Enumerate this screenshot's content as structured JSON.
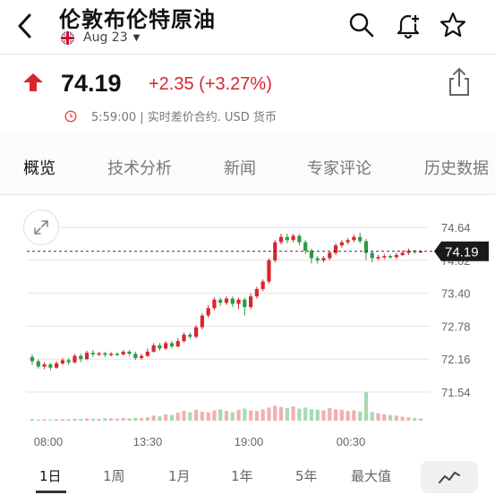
{
  "header": {
    "title": "伦敦布伦特原油",
    "contract": "Aug 23"
  },
  "quote": {
    "price": "74.19",
    "change": "+2.35 (+3.27%)",
    "time_info": "5:59:00 | 实时差价合约. USD 货币"
  },
  "tabs": [
    {
      "label": "概览",
      "active": true
    },
    {
      "label": "技术分析",
      "active": false
    },
    {
      "label": "新闻",
      "active": false
    },
    {
      "label": "专家评论",
      "active": false
    },
    {
      "label": "历史数据",
      "active": false
    }
  ],
  "ranges": [
    {
      "label": "1日",
      "active": true
    },
    {
      "label": "1周",
      "active": false
    },
    {
      "label": "1月",
      "active": false
    },
    {
      "label": "1年",
      "active": false
    },
    {
      "label": "5年",
      "active": false
    },
    {
      "label": "最大值",
      "active": false
    }
  ],
  "colors": {
    "up": "#d9262e",
    "down": "#2e9a46",
    "accent": "#d9262e"
  },
  "chart_data": {
    "type": "candlestick",
    "y_ticks": [
      "74.64",
      "74.02",
      "73.40",
      "72.78",
      "72.16",
      "71.54"
    ],
    "x_ticks": [
      "08:00",
      "13:30",
      "19:00",
      "00:30"
    ],
    "last_price_label": "74.19",
    "ylim": [
      71.54,
      74.64
    ],
    "grid": true,
    "candles": [
      [
        72.2,
        72.12,
        72.25,
        72.05
      ],
      [
        72.12,
        72.02,
        72.15,
        71.98
      ],
      [
        72.02,
        72.06,
        72.1,
        71.97
      ],
      [
        72.06,
        72.0,
        72.09,
        71.95
      ],
      [
        72.0,
        72.08,
        72.12,
        71.98
      ],
      [
        72.08,
        72.14,
        72.18,
        72.05
      ],
      [
        72.14,
        72.1,
        72.18,
        72.05
      ],
      [
        72.1,
        72.22,
        72.26,
        72.08
      ],
      [
        72.22,
        72.16,
        72.26,
        72.1
      ],
      [
        72.16,
        72.28,
        72.32,
        72.14
      ],
      [
        72.28,
        72.25,
        72.33,
        72.2
      ],
      [
        72.25,
        72.27,
        72.3,
        72.22
      ],
      [
        72.27,
        72.24,
        72.3,
        72.2
      ],
      [
        72.24,
        72.26,
        72.29,
        72.21
      ],
      [
        72.26,
        72.25,
        72.29,
        72.22
      ],
      [
        72.25,
        72.3,
        72.33,
        72.23
      ],
      [
        72.3,
        72.26,
        72.33,
        72.22
      ],
      [
        72.26,
        72.18,
        72.3,
        72.14
      ],
      [
        72.18,
        72.22,
        72.26,
        72.15
      ],
      [
        72.22,
        72.3,
        72.36,
        72.2
      ],
      [
        72.3,
        72.42,
        72.46,
        72.28
      ],
      [
        72.42,
        72.36,
        72.46,
        72.32
      ],
      [
        72.36,
        72.46,
        72.5,
        72.33
      ],
      [
        72.46,
        72.4,
        72.5,
        72.36
      ],
      [
        72.4,
        72.5,
        72.55,
        72.38
      ],
      [
        72.5,
        72.62,
        72.66,
        72.47
      ],
      [
        72.62,
        72.58,
        72.66,
        72.54
      ],
      [
        72.58,
        72.76,
        72.8,
        72.55
      ],
      [
        72.76,
        72.98,
        73.02,
        72.72
      ],
      [
        72.98,
        73.12,
        73.18,
        72.94
      ],
      [
        73.12,
        73.28,
        73.32,
        73.08
      ],
      [
        73.28,
        73.22,
        73.32,
        73.16
      ],
      [
        73.22,
        73.3,
        73.34,
        73.18
      ],
      [
        73.3,
        73.2,
        73.34,
        73.14
      ],
      [
        73.2,
        73.28,
        73.32,
        73.1
      ],
      [
        73.28,
        73.14,
        73.32,
        72.98
      ],
      [
        73.14,
        73.34,
        73.4,
        73.1
      ],
      [
        73.34,
        73.48,
        73.52,
        73.3
      ],
      [
        73.48,
        73.62,
        73.66,
        73.44
      ],
      [
        73.62,
        74.02,
        74.06,
        73.58
      ],
      [
        74.02,
        74.36,
        74.4,
        73.98
      ],
      [
        74.36,
        74.46,
        74.52,
        74.32
      ],
      [
        74.46,
        74.4,
        74.52,
        74.34
      ],
      [
        74.4,
        74.48,
        74.52,
        74.36
      ],
      [
        74.48,
        74.36,
        74.52,
        74.3
      ],
      [
        74.36,
        74.2,
        74.4,
        74.14
      ],
      [
        74.2,
        74.06,
        74.24,
        73.96
      ],
      [
        74.06,
        74.02,
        74.1,
        73.96
      ],
      [
        74.02,
        74.06,
        74.1,
        73.98
      ],
      [
        74.06,
        74.16,
        74.2,
        74.02
      ],
      [
        74.16,
        74.3,
        74.34,
        74.12
      ],
      [
        74.3,
        74.36,
        74.4,
        74.26
      ],
      [
        74.36,
        74.4,
        74.44,
        74.32
      ],
      [
        74.4,
        74.46,
        74.5,
        74.36
      ],
      [
        74.46,
        74.38,
        74.54,
        74.34
      ],
      [
        74.38,
        74.16,
        74.42,
        74.02
      ],
      [
        74.16,
        74.06,
        74.2,
        73.98
      ],
      [
        74.06,
        74.08,
        74.12,
        74.02
      ],
      [
        74.08,
        74.1,
        74.14,
        74.04
      ],
      [
        74.1,
        74.08,
        74.13,
        74.05
      ],
      [
        74.08,
        74.12,
        74.16,
        74.04
      ],
      [
        74.12,
        74.16,
        74.2,
        74.1
      ],
      [
        74.16,
        74.2,
        74.24,
        74.12
      ],
      [
        74.2,
        74.18,
        74.22,
        74.14
      ],
      [
        74.18,
        74.19,
        74.21,
        74.16
      ]
    ],
    "volumes": [
      0.06,
      0.04,
      0.05,
      0.04,
      0.05,
      0.06,
      0.05,
      0.07,
      0.06,
      0.08,
      0.07,
      0.06,
      0.09,
      0.08,
      0.07,
      0.09,
      0.08,
      0.1,
      0.09,
      0.12,
      0.18,
      0.15,
      0.22,
      0.2,
      0.28,
      0.34,
      0.3,
      0.38,
      0.32,
      0.3,
      0.36,
      0.4,
      0.34,
      0.3,
      0.38,
      0.42,
      0.36,
      0.34,
      0.4,
      0.46,
      0.52,
      0.48,
      0.44,
      0.5,
      0.42,
      0.46,
      0.4,
      0.38,
      0.36,
      0.44,
      0.4,
      0.38,
      0.34,
      0.36,
      0.32,
      1.0,
      0.3,
      0.26,
      0.22,
      0.2,
      0.18,
      0.14,
      0.12,
      0.1,
      0.08
    ]
  }
}
